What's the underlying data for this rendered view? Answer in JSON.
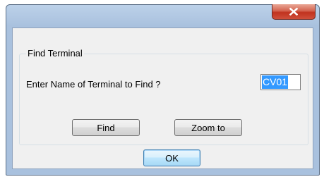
{
  "dialog": {
    "close_icon": "close-x-icon",
    "group_title": "Find Terminal",
    "prompt_label": "Enter Name of Terminal to Find ?",
    "terminal_name_value": "CV01",
    "find_label": "Find",
    "zoom_label": "Zoom to",
    "ok_label": "OK"
  },
  "colors": {
    "frame": "#a9c1de",
    "close_button": "#c1321f",
    "selection": "#3399ff",
    "client": "#f0f0f0"
  }
}
